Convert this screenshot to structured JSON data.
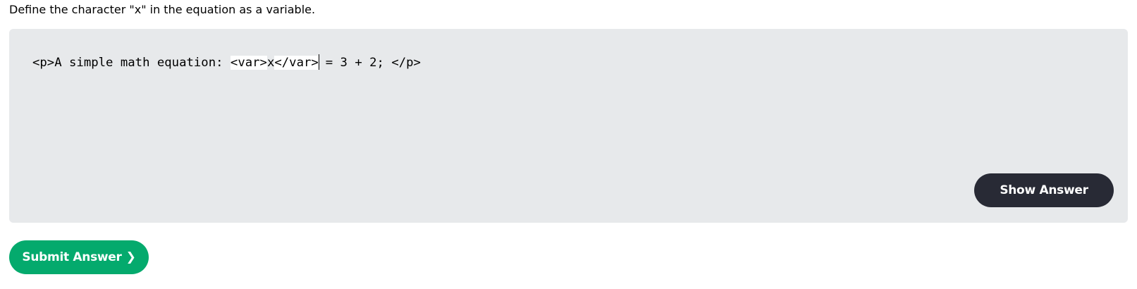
{
  "instructions": "Define the character \"x\" in the equation as a variable.",
  "editor": {
    "segments": {
      "before": "<p>A simple math equation: ",
      "var_open": "<var>",
      "var_content": "x",
      "var_close": "</var>",
      "after": " = 3 + 2; </p>"
    }
  },
  "buttons": {
    "show_answer_label": "Show Answer",
    "submit_answer_label": "Submit Answer",
    "submit_chevron": "❯"
  },
  "colors": {
    "editor_background": "#e7e9eb",
    "show_answer_background": "#282a35",
    "submit_background": "#04aa6d",
    "highlight": "#ffffff"
  }
}
